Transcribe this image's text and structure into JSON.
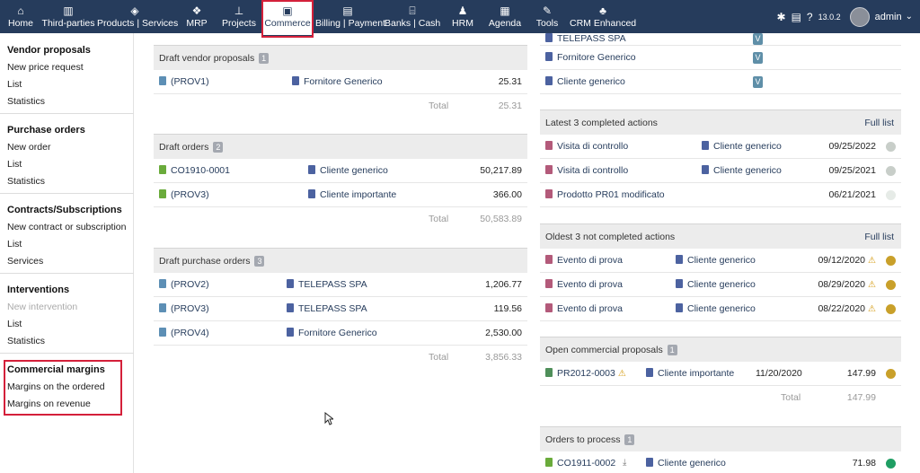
{
  "topbar": {
    "nav": [
      {
        "label": "Home",
        "icon": "home-icon",
        "glyph": "⌂"
      },
      {
        "label": "Third-parties",
        "icon": "building-icon",
        "glyph": "▥"
      },
      {
        "label": "Products | Services",
        "icon": "cube-icon",
        "glyph": "◈"
      },
      {
        "label": "MRP",
        "icon": "cubes-icon",
        "glyph": "❖"
      },
      {
        "label": "Projects",
        "icon": "sitemap-icon",
        "glyph": "⊥"
      },
      {
        "label": "Commerce",
        "icon": "briefcase-icon",
        "glyph": "▣"
      },
      {
        "label": "Billing | Payment",
        "icon": "money-icon",
        "glyph": "▤"
      },
      {
        "label": "Banks | Cash",
        "icon": "bank-icon",
        "glyph": "⌸"
      },
      {
        "label": "HRM",
        "icon": "user-icon",
        "glyph": "♟"
      },
      {
        "label": "Agenda",
        "icon": "calendar-icon",
        "glyph": "▦"
      },
      {
        "label": "Tools",
        "icon": "wrench-icon",
        "glyph": "✎"
      },
      {
        "label": "CRM Enhanced",
        "icon": "users-icon",
        "glyph": "♣"
      }
    ],
    "version": "13.0.2",
    "user": "admin"
  },
  "sidebar": {
    "sections": [
      {
        "title": "Vendor proposals",
        "links": [
          "New price request",
          "List",
          "Statistics"
        ]
      },
      {
        "title": "Purchase orders",
        "links": [
          "New order",
          "List",
          "Statistics"
        ]
      },
      {
        "title": "Contracts/Subscriptions",
        "links": [
          "New contract or subscription",
          "List",
          "Services"
        ]
      },
      {
        "title": "Interventions",
        "links": [
          "New intervention",
          "List",
          "Statistics"
        ]
      },
      {
        "title": "Commercial margins",
        "links": [
          "Margins on the ordered",
          "Margins on revenue"
        ]
      }
    ]
  },
  "left": {
    "draft_vendor": {
      "title": "Draft vendor proposals",
      "count": "1",
      "rows": [
        {
          "ref": "(PROV1)",
          "party": "Fornitore Generico",
          "amount": "25.31"
        }
      ],
      "total_label": "Total",
      "total": "25.31"
    },
    "draft_orders": {
      "title": "Draft orders",
      "count": "2",
      "rows": [
        {
          "ref": "CO1910-0001",
          "party": "Cliente generico",
          "amount": "50,217.89"
        },
        {
          "ref": "(PROV3)",
          "party": "Cliente importante",
          "amount": "366.00"
        }
      ],
      "total_label": "Total",
      "total": "50,583.89"
    },
    "draft_purchase": {
      "title": "Draft purchase orders",
      "count": "3",
      "rows": [
        {
          "ref": "(PROV2)",
          "party": "TELEPASS SPA",
          "amount": "1,206.77"
        },
        {
          "ref": "(PROV3)",
          "party": "TELEPASS SPA",
          "amount": "119.56"
        },
        {
          "ref": "(PROV4)",
          "party": "Fornitore Generico",
          "amount": "2,530.00"
        }
      ],
      "total_label": "Total",
      "total": "3,856.33"
    }
  },
  "right": {
    "top_list": {
      "rows": [
        {
          "party": "TELEPASS SPA",
          "status": "V"
        },
        {
          "party": "Fornitore Generico",
          "status": "V"
        },
        {
          "party": "Cliente generico",
          "status": "V"
        }
      ]
    },
    "completed": {
      "title": "Latest 3 completed actions",
      "link": "Full list",
      "rows": [
        {
          "label": "Visita di controllo",
          "party": "Cliente generico",
          "date": "09/25/2022"
        },
        {
          "label": "Visita di controllo",
          "party": "Cliente generico",
          "date": "09/25/2021"
        },
        {
          "label": "Prodotto PR01 modificato",
          "party": "",
          "date": "06/21/2021"
        }
      ]
    },
    "not_completed": {
      "title": "Oldest 3 not completed actions",
      "link": "Full list",
      "rows": [
        {
          "label": "Evento di prova",
          "party": "Cliente generico",
          "date": "09/12/2020"
        },
        {
          "label": "Evento di prova",
          "party": "Cliente generico",
          "date": "08/29/2020"
        },
        {
          "label": "Evento di prova",
          "party": "Cliente generico",
          "date": "08/22/2020"
        }
      ]
    },
    "proposals": {
      "title": "Open commercial proposals",
      "count": "1",
      "rows": [
        {
          "ref": "PR2012-0003",
          "party": "Cliente importante",
          "date": "11/20/2020",
          "amount": "147.99"
        }
      ],
      "total_label": "Total",
      "total": "147.99"
    },
    "orders": {
      "title": "Orders to process",
      "count": "1",
      "rows": [
        {
          "ref": "CO1911-0002",
          "party": "Cliente generico",
          "amount": "71.98"
        }
      ]
    }
  },
  "colors": {
    "topbar": "#263c5c",
    "highlight": "#d4203a",
    "status_grey": "#c8cec9",
    "status_yellow": "#c9a02a",
    "status_green": "#1f9e63"
  }
}
